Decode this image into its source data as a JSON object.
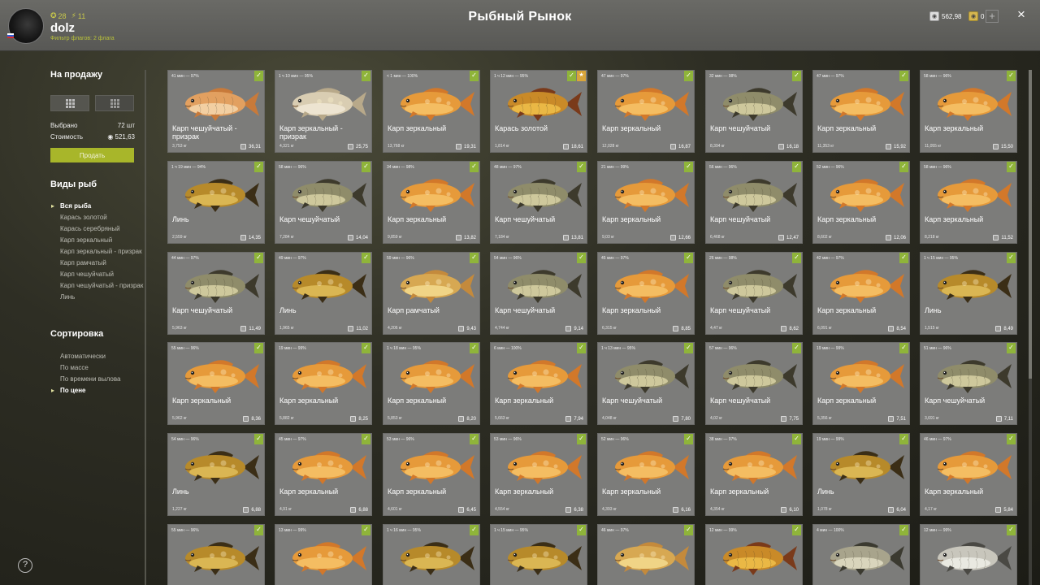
{
  "header": {
    "title": "Рыбный Рынок",
    "username": "dolz",
    "subtitle": "Фильтр флагов: 2 флага",
    "level": "28",
    "bonus": "11",
    "silver": "562,98",
    "gold": "0",
    "plus_label": "+",
    "close_label": "×"
  },
  "sidebar": {
    "for_sale_title": "На продажу",
    "selected_label": "Выбрано",
    "selected_value": "72 шт",
    "cost_label": "Стоимость",
    "cost_value": "521,63",
    "sell_button": "Продать",
    "species_title": "Виды рыб",
    "species": [
      {
        "label": "Вся рыба",
        "active": true
      },
      {
        "label": "Карась золотой"
      },
      {
        "label": "Карась серебряный"
      },
      {
        "label": "Карп зеркальный"
      },
      {
        "label": "Карп зеркальный - призрак"
      },
      {
        "label": "Карп рамчатый"
      },
      {
        "label": "Карп чешуйчатый"
      },
      {
        "label": "Карп чешуйчатый - призрак"
      },
      {
        "label": "Линь"
      }
    ],
    "sort_title": "Сортировка",
    "sort": [
      {
        "label": "Автоматически"
      },
      {
        "label": "По массе"
      },
      {
        "label": "По времени вылова"
      },
      {
        "label": "По цене",
        "active": true
      }
    ],
    "help_label": "?"
  },
  "colors": {
    "accent": "#a8b62a",
    "check": "#8fb43a",
    "star": "#d9a53a"
  },
  "fish": [
    {
      "meta": "41 мин — 97%",
      "name": "Карп чешуйчатый - призрак",
      "weight": "3,753 кг",
      "price": "36,31",
      "kind": "ghost-scaly"
    },
    {
      "meta": "1 ч 10 мин — 95%",
      "name": "Карп зеркальный - призрак",
      "weight": "4,321 кг",
      "price": "25,75",
      "kind": "ghost-mirror"
    },
    {
      "meta": "< 1 мин — 100%",
      "name": "Карп зеркальный",
      "weight": "13,768 кг",
      "price": "19,31",
      "kind": "mirror"
    },
    {
      "meta": "1 ч 12 мин — 95%",
      "name": "Карась золотой",
      "weight": "1,814 кг",
      "price": "18,61",
      "kind": "crucian",
      "star": true
    },
    {
      "meta": "47 мин — 97%",
      "name": "Карп зеркальный",
      "weight": "12,028 кг",
      "price": "16,87",
      "kind": "mirror"
    },
    {
      "meta": "32 мин — 98%",
      "name": "Карп чешуйчатый",
      "weight": "8,394 кг",
      "price": "16,18",
      "kind": "scaly"
    },
    {
      "meta": "47 мин — 97%",
      "name": "Карп зеркальный",
      "weight": "11,353 кг",
      "price": "15,92",
      "kind": "mirror"
    },
    {
      "meta": "58 мин — 96%",
      "name": "Карп зеркальный",
      "weight": "11,055 кг",
      "price": "15,50",
      "kind": "mirror"
    },
    {
      "meta": "1 ч 19 мин — 94%",
      "name": "Линь",
      "weight": "2,559 кг",
      "price": "14,35",
      "kind": "tench"
    },
    {
      "meta": "58 мин — 96%",
      "name": "Карп чешуйчатый",
      "weight": "7,284 кг",
      "price": "14,04",
      "kind": "scaly"
    },
    {
      "meta": "34 мин — 98%",
      "name": "Карп зеркальный",
      "weight": "9,859 кг",
      "price": "13,82",
      "kind": "mirror"
    },
    {
      "meta": "48 мин — 97%",
      "name": "Карп чешуйчатый",
      "weight": "7,184 кг",
      "price": "13,81",
      "kind": "scaly"
    },
    {
      "meta": "21 мин — 99%",
      "name": "Карп зеркальный",
      "weight": "9,03 кг",
      "price": "12,66",
      "kind": "mirror"
    },
    {
      "meta": "56 мин — 96%",
      "name": "Карп чешуйчатый",
      "weight": "6,468 кг",
      "price": "12,47",
      "kind": "scaly"
    },
    {
      "meta": "52 мин — 96%",
      "name": "Карп зеркальный",
      "weight": "8,602 кг",
      "price": "12,06",
      "kind": "mirror"
    },
    {
      "meta": "58 мин — 96%",
      "name": "Карп зеркальный",
      "weight": "8,218 кг",
      "price": "11,52",
      "kind": "mirror"
    },
    {
      "meta": "44 мин — 97%",
      "name": "Карп чешуйчатый",
      "weight": "5,963 кг",
      "price": "11,49",
      "kind": "scaly"
    },
    {
      "meta": "49 мин — 97%",
      "name": "Линь",
      "weight": "1,965 кг",
      "price": "11,02",
      "kind": "tench"
    },
    {
      "meta": "59 мин — 96%",
      "name": "Карп рамчатый",
      "weight": "4,206 кг",
      "price": "9,43",
      "kind": "frame"
    },
    {
      "meta": "54 мин — 96%",
      "name": "Карп чешуйчатый",
      "weight": "4,744 кг",
      "price": "9,14",
      "kind": "scaly"
    },
    {
      "meta": "45 мин — 97%",
      "name": "Карп зеркальный",
      "weight": "6,315 кг",
      "price": "8,85",
      "kind": "mirror"
    },
    {
      "meta": "26 мин — 98%",
      "name": "Карп чешуйчатый",
      "weight": "4,47 кг",
      "price": "8,62",
      "kind": "scaly"
    },
    {
      "meta": "42 мин — 97%",
      "name": "Карп зеркальный",
      "weight": "6,091 кг",
      "price": "8,54",
      "kind": "mirror"
    },
    {
      "meta": "1 ч 15 мин — 95%",
      "name": "Линь",
      "weight": "1,515 кг",
      "price": "8,49",
      "kind": "tench"
    },
    {
      "meta": "55 мин — 96%",
      "name": "Карп зеркальный",
      "weight": "5,962 кг",
      "price": "8,36",
      "kind": "mirror"
    },
    {
      "meta": "19 мин — 99%",
      "name": "Карп зеркальный",
      "weight": "5,882 кг",
      "price": "8,25",
      "kind": "mirror"
    },
    {
      "meta": "1 ч 18 мин — 95%",
      "name": "Карп зеркальный",
      "weight": "5,853 кг",
      "price": "8,20",
      "kind": "mirror"
    },
    {
      "meta": "6 мин — 100%",
      "name": "Карп зеркальный",
      "weight": "5,663 кг",
      "price": "7,94",
      "kind": "mirror"
    },
    {
      "meta": "1 ч 13 мин — 95%",
      "name": "Карп чешуйчатый",
      "weight": "4,048 кг",
      "price": "7,80",
      "kind": "scaly"
    },
    {
      "meta": "57 мин — 96%",
      "name": "Карп чешуйчатый",
      "weight": "4,02 кг",
      "price": "7,75",
      "kind": "scaly"
    },
    {
      "meta": "19 мин — 99%",
      "name": "Карп зеркальный",
      "weight": "5,356 кг",
      "price": "7,51",
      "kind": "mirror"
    },
    {
      "meta": "51 мин — 96%",
      "name": "Карп чешуйчатый",
      "weight": "3,691 кг",
      "price": "7,11",
      "kind": "scaly"
    },
    {
      "meta": "54 мин — 96%",
      "name": "Линь",
      "weight": "1,227 кг",
      "price": "6,88",
      "kind": "tench"
    },
    {
      "meta": "45 мин — 97%",
      "name": "Карп зеркальный",
      "weight": "4,91 кг",
      "price": "6,88",
      "kind": "mirror"
    },
    {
      "meta": "53 мин — 96%",
      "name": "Карп зеркальный",
      "weight": "4,601 кг",
      "price": "6,45",
      "kind": "mirror"
    },
    {
      "meta": "53 мин — 96%",
      "name": "Карп зеркальный",
      "weight": "4,554 кг",
      "price": "6,38",
      "kind": "mirror"
    },
    {
      "meta": "52 мин — 96%",
      "name": "Карп зеркальный",
      "weight": "4,393 кг",
      "price": "6,16",
      "kind": "mirror"
    },
    {
      "meta": "38 мин — 97%",
      "name": "Карп зеркальный",
      "weight": "4,354 кг",
      "price": "6,10",
      "kind": "mirror"
    },
    {
      "meta": "19 мин — 99%",
      "name": "Линь",
      "weight": "1,078 кг",
      "price": "6,04",
      "kind": "tench"
    },
    {
      "meta": "46 мин — 97%",
      "name": "Карп зеркальный",
      "weight": "4,17 кг",
      "price": "5,84",
      "kind": "mirror"
    },
    {
      "meta": "55 мин — 96%",
      "name": "",
      "weight": "",
      "price": "",
      "kind": "tench"
    },
    {
      "meta": "13 мин — 99%",
      "name": "",
      "weight": "",
      "price": "",
      "kind": "mirror"
    },
    {
      "meta": "1 ч 16 мин — 95%",
      "name": "",
      "weight": "",
      "price": "",
      "kind": "tench"
    },
    {
      "meta": "1 ч 15 мин — 95%",
      "name": "",
      "weight": "",
      "price": "",
      "kind": "tench"
    },
    {
      "meta": "46 мин — 97%",
      "name": "",
      "weight": "",
      "price": "",
      "kind": "frame"
    },
    {
      "meta": "12 мин — 99%",
      "name": "",
      "weight": "",
      "price": "",
      "kind": "crucian"
    },
    {
      "meta": "4 мин — 100%",
      "name": "",
      "weight": "",
      "price": "",
      "kind": "silver"
    },
    {
      "meta": "12 мин — 99%",
      "name": "",
      "weight": "",
      "price": "",
      "kind": "silver-white"
    }
  ]
}
